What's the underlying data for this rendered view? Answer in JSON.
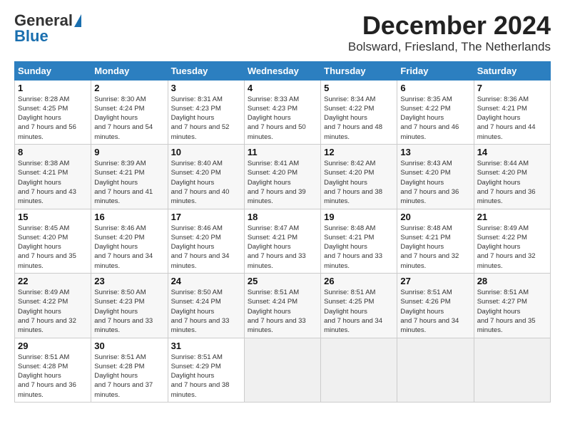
{
  "header": {
    "logo_general": "General",
    "logo_blue": "Blue",
    "month_title": "December 2024",
    "location": "Bolsward, Friesland, The Netherlands"
  },
  "days_of_week": [
    "Sunday",
    "Monday",
    "Tuesday",
    "Wednesday",
    "Thursday",
    "Friday",
    "Saturday"
  ],
  "weeks": [
    [
      {
        "day": "1",
        "sunrise": "8:28 AM",
        "sunset": "4:25 PM",
        "daylight": "7 hours and 56 minutes."
      },
      {
        "day": "2",
        "sunrise": "8:30 AM",
        "sunset": "4:24 PM",
        "daylight": "7 hours and 54 minutes."
      },
      {
        "day": "3",
        "sunrise": "8:31 AM",
        "sunset": "4:23 PM",
        "daylight": "7 hours and 52 minutes."
      },
      {
        "day": "4",
        "sunrise": "8:33 AM",
        "sunset": "4:23 PM",
        "daylight": "7 hours and 50 minutes."
      },
      {
        "day": "5",
        "sunrise": "8:34 AM",
        "sunset": "4:22 PM",
        "daylight": "7 hours and 48 minutes."
      },
      {
        "day": "6",
        "sunrise": "8:35 AM",
        "sunset": "4:22 PM",
        "daylight": "7 hours and 46 minutes."
      },
      {
        "day": "7",
        "sunrise": "8:36 AM",
        "sunset": "4:21 PM",
        "daylight": "7 hours and 44 minutes."
      }
    ],
    [
      {
        "day": "8",
        "sunrise": "8:38 AM",
        "sunset": "4:21 PM",
        "daylight": "7 hours and 43 minutes."
      },
      {
        "day": "9",
        "sunrise": "8:39 AM",
        "sunset": "4:21 PM",
        "daylight": "7 hours and 41 minutes."
      },
      {
        "day": "10",
        "sunrise": "8:40 AM",
        "sunset": "4:20 PM",
        "daylight": "7 hours and 40 minutes."
      },
      {
        "day": "11",
        "sunrise": "8:41 AM",
        "sunset": "4:20 PM",
        "daylight": "7 hours and 39 minutes."
      },
      {
        "day": "12",
        "sunrise": "8:42 AM",
        "sunset": "4:20 PM",
        "daylight": "7 hours and 38 minutes."
      },
      {
        "day": "13",
        "sunrise": "8:43 AM",
        "sunset": "4:20 PM",
        "daylight": "7 hours and 36 minutes."
      },
      {
        "day": "14",
        "sunrise": "8:44 AM",
        "sunset": "4:20 PM",
        "daylight": "7 hours and 36 minutes."
      }
    ],
    [
      {
        "day": "15",
        "sunrise": "8:45 AM",
        "sunset": "4:20 PM",
        "daylight": "7 hours and 35 minutes."
      },
      {
        "day": "16",
        "sunrise": "8:46 AM",
        "sunset": "4:20 PM",
        "daylight": "7 hours and 34 minutes."
      },
      {
        "day": "17",
        "sunrise": "8:46 AM",
        "sunset": "4:20 PM",
        "daylight": "7 hours and 34 minutes."
      },
      {
        "day": "18",
        "sunrise": "8:47 AM",
        "sunset": "4:21 PM",
        "daylight": "7 hours and 33 minutes."
      },
      {
        "day": "19",
        "sunrise": "8:48 AM",
        "sunset": "4:21 PM",
        "daylight": "7 hours and 33 minutes."
      },
      {
        "day": "20",
        "sunrise": "8:48 AM",
        "sunset": "4:21 PM",
        "daylight": "7 hours and 32 minutes."
      },
      {
        "day": "21",
        "sunrise": "8:49 AM",
        "sunset": "4:22 PM",
        "daylight": "7 hours and 32 minutes."
      }
    ],
    [
      {
        "day": "22",
        "sunrise": "8:49 AM",
        "sunset": "4:22 PM",
        "daylight": "7 hours and 32 minutes."
      },
      {
        "day": "23",
        "sunrise": "8:50 AM",
        "sunset": "4:23 PM",
        "daylight": "7 hours and 33 minutes."
      },
      {
        "day": "24",
        "sunrise": "8:50 AM",
        "sunset": "4:24 PM",
        "daylight": "7 hours and 33 minutes."
      },
      {
        "day": "25",
        "sunrise": "8:51 AM",
        "sunset": "4:24 PM",
        "daylight": "7 hours and 33 minutes."
      },
      {
        "day": "26",
        "sunrise": "8:51 AM",
        "sunset": "4:25 PM",
        "daylight": "7 hours and 34 minutes."
      },
      {
        "day": "27",
        "sunrise": "8:51 AM",
        "sunset": "4:26 PM",
        "daylight": "7 hours and 34 minutes."
      },
      {
        "day": "28",
        "sunrise": "8:51 AM",
        "sunset": "4:27 PM",
        "daylight": "7 hours and 35 minutes."
      }
    ],
    [
      {
        "day": "29",
        "sunrise": "8:51 AM",
        "sunset": "4:28 PM",
        "daylight": "7 hours and 36 minutes."
      },
      {
        "day": "30",
        "sunrise": "8:51 AM",
        "sunset": "4:28 PM",
        "daylight": "7 hours and 37 minutes."
      },
      {
        "day": "31",
        "sunrise": "8:51 AM",
        "sunset": "4:29 PM",
        "daylight": "7 hours and 38 minutes."
      },
      null,
      null,
      null,
      null
    ]
  ]
}
